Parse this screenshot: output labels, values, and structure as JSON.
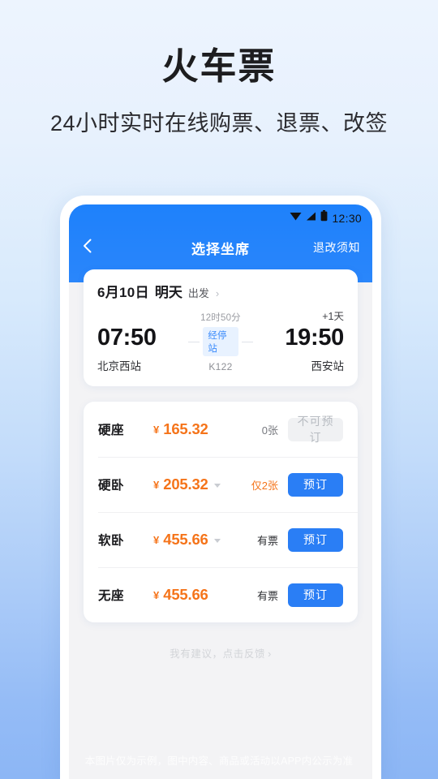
{
  "promo": {
    "title": "火车票",
    "subtitle": "24小时实时在线购票、退票、改签"
  },
  "phone": {
    "status_bar": {
      "time": "12:30",
      "icons": [
        "wifi-icon",
        "signal-icon",
        "battery-icon"
      ]
    },
    "nav": {
      "back_icon": "chevron-left-icon",
      "title": "选择坐席",
      "right_link": "退改须知"
    },
    "trip": {
      "date": "6月10日",
      "day_label": "明天",
      "depart_label": "出发",
      "chevron": "›",
      "depart_time": "07:50",
      "depart_station": "北京西站",
      "duration": "12时50分",
      "stop_label": "经停站",
      "train_no": "K122",
      "plus_day": "+1天",
      "arrive_time": "19:50",
      "arrive_station": "西安站"
    },
    "seats": [
      {
        "name": "硬座",
        "currency": "¥",
        "price": "165.32",
        "has_caret": false,
        "stock": "0张",
        "stock_style": "normal",
        "button": "不可预订",
        "enabled": false
      },
      {
        "name": "硬卧",
        "currency": "¥",
        "price": "205.32",
        "has_caret": true,
        "stock": "仅2张",
        "stock_style": "warn",
        "button": "预订",
        "enabled": true
      },
      {
        "name": "软卧",
        "currency": "¥",
        "price": "455.66",
        "has_caret": true,
        "stock": "有票",
        "stock_style": "ok",
        "button": "预订",
        "enabled": true
      },
      {
        "name": "无座",
        "currency": "¥",
        "price": "455.66",
        "has_caret": false,
        "stock": "有票",
        "stock_style": "ok",
        "button": "预订",
        "enabled": true
      }
    ],
    "feedback": {
      "text": "我有建议，点击反馈",
      "chevron": "›"
    }
  },
  "disclaimer": "本图片仅为示例，图中内容、商品或活动以APP内公示为准",
  "colors": {
    "brand_blue": "#2a7ef5",
    "header_blue": "#1e81fb",
    "price_orange": "#f5741a",
    "page_bg_top": "#edf4fe",
    "page_bg_bottom": "#8cb6f5",
    "disabled_grey": "#f0f1f3"
  }
}
